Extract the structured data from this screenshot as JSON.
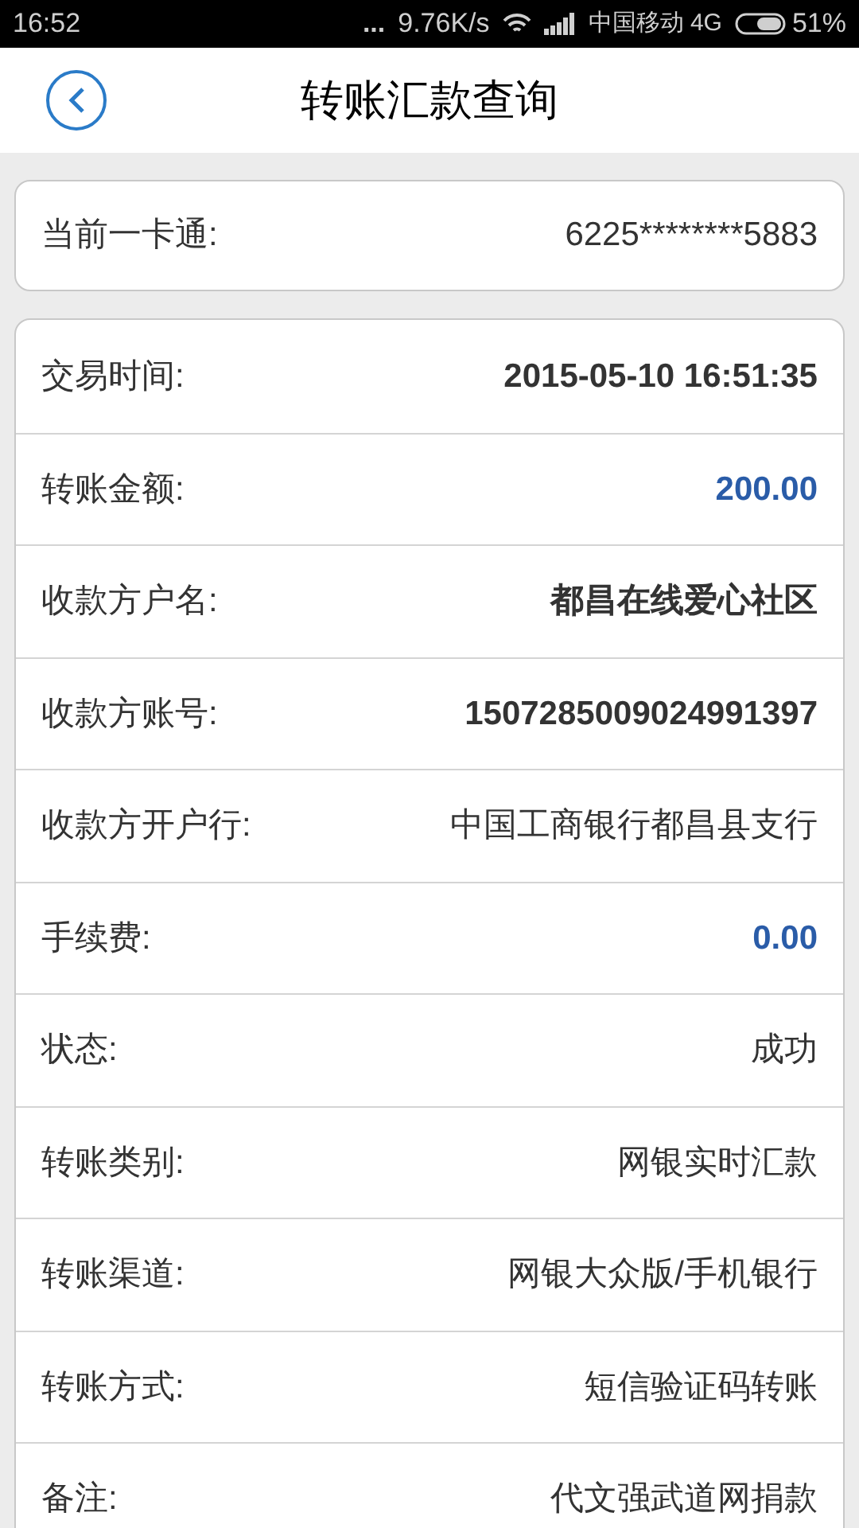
{
  "status_bar": {
    "time": "16:52",
    "dots": "...",
    "speed": "9.76K/s",
    "carrier": "中国移动 4G",
    "battery": "51%"
  },
  "header": {
    "title": "转账汇款查询"
  },
  "card": {
    "label": "当前一卡通:",
    "value": "6225********5883"
  },
  "details": [
    {
      "label": "交易时间:",
      "value": "2015-05-10 16:51:35",
      "kind": "bold"
    },
    {
      "label": "转账金额:",
      "value": "200.00",
      "kind": "amount"
    },
    {
      "label": "收款方户名:",
      "value": "都昌在线爱心社区",
      "kind": "bold"
    },
    {
      "label": "收款方账号:",
      "value": "1507285009024991397",
      "kind": "bold"
    },
    {
      "label": "收款方开户行:",
      "value": "中国工商银行都昌县支行",
      "kind": "plain"
    },
    {
      "label": "手续费:",
      "value": "0.00",
      "kind": "amount"
    },
    {
      "label": "状态:",
      "value": "成功",
      "kind": "plain"
    },
    {
      "label": "转账类别:",
      "value": "网银实时汇款",
      "kind": "plain"
    },
    {
      "label": "转账渠道:",
      "value": "网银大众版/手机银行",
      "kind": "plain"
    },
    {
      "label": "转账方式:",
      "value": "短信验证码转账",
      "kind": "plain"
    },
    {
      "label": "备注:",
      "value": "代文强武道网捐款",
      "kind": "plain"
    }
  ]
}
